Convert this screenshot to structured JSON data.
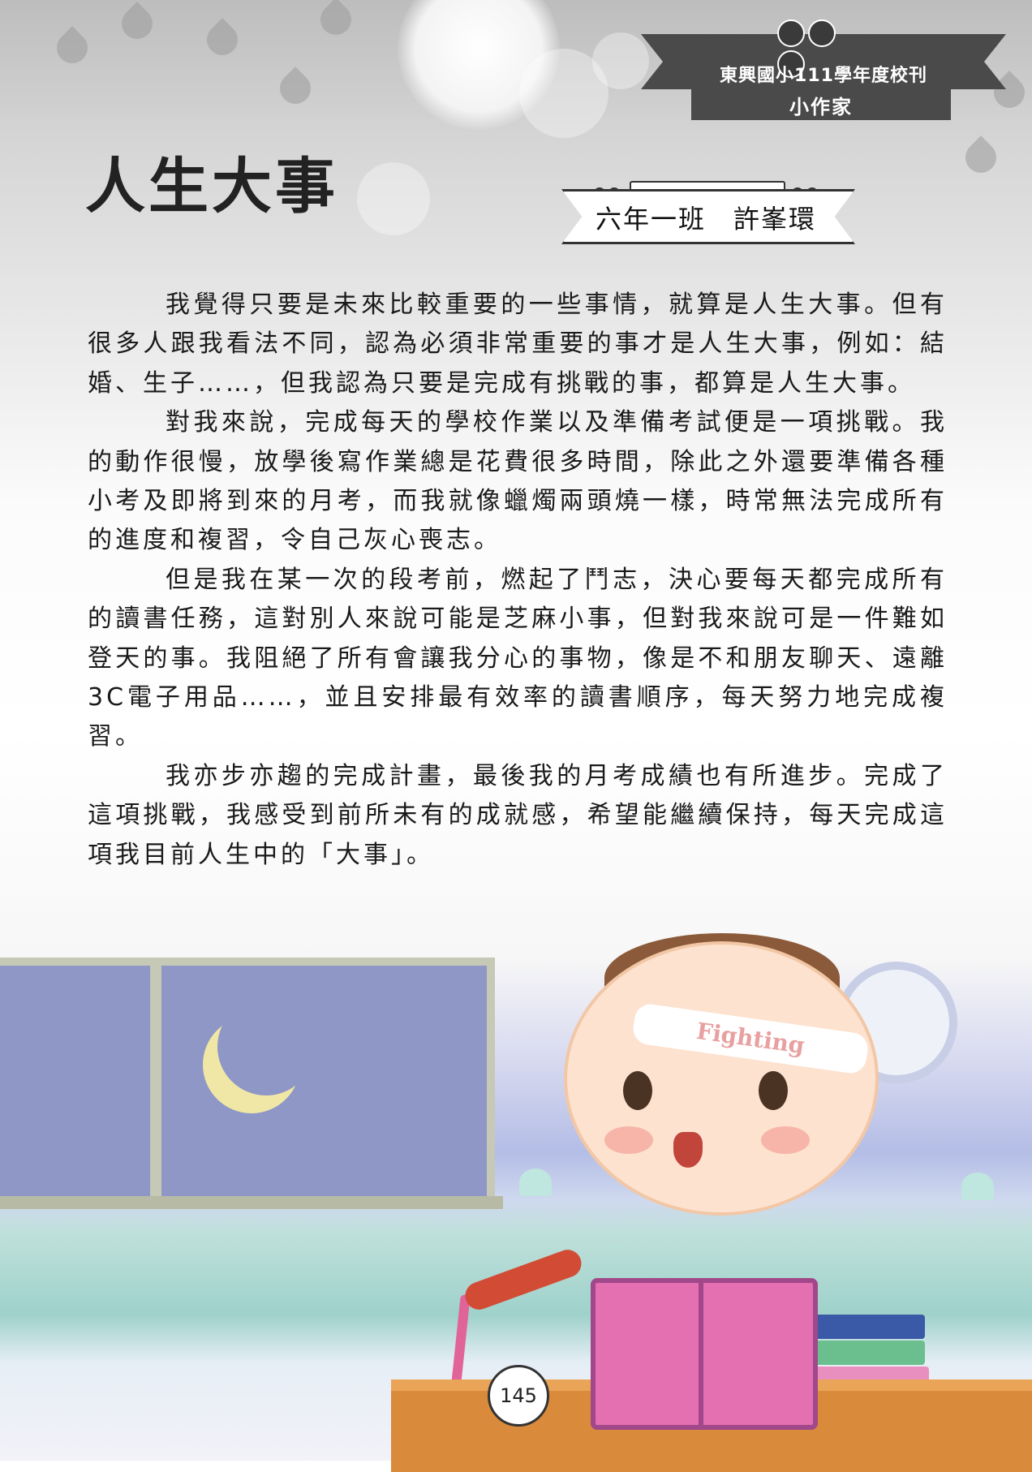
{
  "header": {
    "banner_line1": "東興國小111學年度校刊",
    "banner_line2": "小作家"
  },
  "article": {
    "title": "人生大事",
    "byline": "六年一班　許峯環",
    "paragraphs": [
      "我覺得只要是未來比較重要的一些事情，就算是人生大事。但有很多人跟我看法不同，認為必須非常重要的事才是人生大事，例如：結婚、生子……，但我認為只要是完成有挑戰的事，都算是人生大事。",
      "對我來說，完成每天的學校作業以及準備考試便是一項挑戰。我的動作很慢，放學後寫作業總是花費很多時間，除此之外還要準備各種小考及即將到來的月考，而我就像蠟燭兩頭燒一樣，時常無法完成所有的進度和複習，令自己灰心喪志。",
      "但是我在某一次的段考前，燃起了鬥志，決心要每天都完成所有的讀書任務，這對別人來說可能是芝麻小事，但對我來說可是一件難如登天的事。我阻絕了所有會讓我分心的事物，像是不和朋友聊天、遠離3C電子用品……，並且安排最有效率的讀書順序，每天努力地完成複習。",
      "我亦步亦趨的完成計畫，最後我的月考成績也有所進步。完成了這項挑戰，我感受到前所未有的成就感，希望能繼續保持，每天完成這項我目前人生中的「大事」。"
    ]
  },
  "illustration": {
    "headband_text": "Fighting"
  },
  "footer": {
    "page_number": "145"
  },
  "colors": {
    "banner": "#4a4a4a",
    "text": "#1a1a1a",
    "book": "#e46fb1",
    "desk": "#d98a3a"
  }
}
